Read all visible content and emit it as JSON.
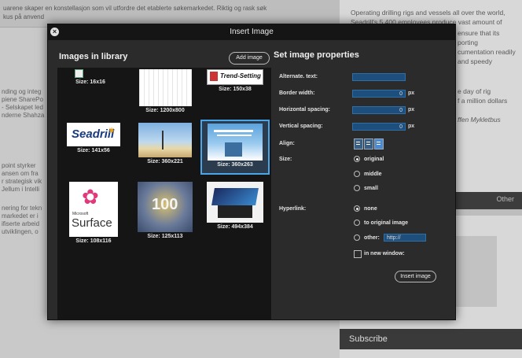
{
  "background": {
    "top_text_1": "uarene skaper en konstellasjon som vil utfordre det etablerte søkemarkedet. Riktig og rask søk",
    "top_text_2": "kus på anvend",
    "left_fragments": [
      "nding og integ",
      "piene SharePo",
      "- Selskapet led",
      "nderne Shahza",
      "point styrker",
      "ansen om fra",
      "r strategisk vik",
      "Jellum i Intelli",
      "nering for tekn",
      "markedet er i",
      "ifiserte arbeid",
      "utviklingen, o"
    ],
    "right_paragraph": [
      "Operating drilling rigs and vessels all over the world,",
      "Seadrill's 5,400 employees produce vast amount of",
      "ensure that its",
      "porting",
      "cumentation readily",
      "and speedy",
      "e day of rig",
      "f a million dollars",
      "ffen Mykletbus"
    ],
    "other_tab": "Other",
    "subscribe": "Subscribe"
  },
  "modal": {
    "title": "Insert Image",
    "close_symbol": "×",
    "library_title": "Images in library",
    "add_image_label": "Add image",
    "properties_title": "Set image properties",
    "images": [
      {
        "caption": "Size: 16x16"
      },
      {
        "caption": "Size: 1200x800"
      },
      {
        "caption": "Size: 150x38",
        "logo_text": "Trend-Setting"
      },
      {
        "caption": "Size: 141x56",
        "logo_text": "Seadrill"
      },
      {
        "caption": "Size: 360x221"
      },
      {
        "caption": "Size: 360x263"
      },
      {
        "caption": "Size: 108x116",
        "logo_text_1": "Microsoft",
        "logo_text_2": "Surface"
      },
      {
        "caption": "Size: 125x113",
        "logo_text": "100"
      },
      {
        "caption": "Size: 494x384"
      }
    ],
    "selected_index": 5,
    "properties": {
      "alt_label": "Alternate. text:",
      "alt_value": "",
      "border_label": "Border width:",
      "border_value": "0",
      "hspacing_label": "Horizontal spacing:",
      "hspacing_value": "0",
      "vspacing_label": "Vertical spacing:",
      "vspacing_value": "0",
      "unit": "px",
      "align_label": "Align:",
      "size_label": "Size:",
      "size_options": [
        "original",
        "middle",
        "small"
      ],
      "size_selected": "original",
      "hyperlink_label": "Hyperlink:",
      "hyperlink_options": [
        "none",
        "to original image",
        "other:"
      ],
      "hyperlink_selected": "none",
      "url_placeholder": "http://",
      "new_window_label": "in new window:",
      "insert_label": "Insert image"
    }
  },
  "colors": {
    "modal_bg": "#2b2b2b",
    "library_bg": "#151515",
    "selection": "#4aa6e8",
    "input_bg": "#1e4f7c"
  }
}
